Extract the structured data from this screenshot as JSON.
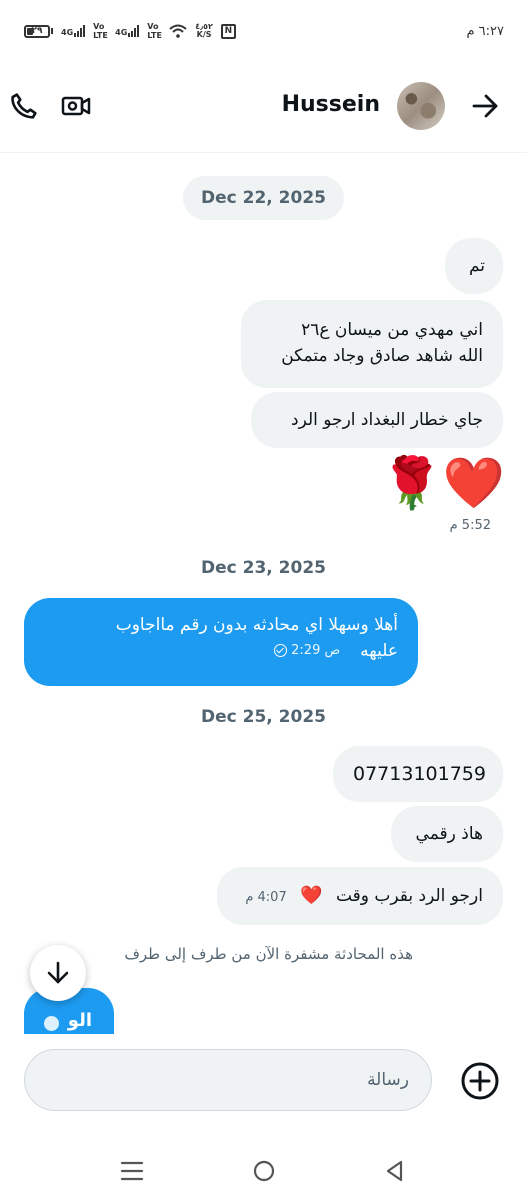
{
  "status_bar": {
    "time": "٦:٢٧ م",
    "battery_level": "٢٩",
    "network_1": "4G",
    "volte_1": "Vo LTE",
    "network_2": "4G",
    "volte_2": "Vo LTE",
    "speed_value": "٤٫٥٢",
    "speed_unit": "K/S",
    "nfc": "N"
  },
  "header": {
    "contact_name": "Hussein",
    "icons": [
      "phone-icon",
      "video-call-icon",
      "back-arrow-icon"
    ]
  },
  "date_separators": [
    "Dec 22, 2025",
    "Dec 23, 2025",
    "Dec 25, 2025"
  ],
  "messages": [
    {
      "text": "تم"
    },
    {
      "line1": "اني مهدي من ميسان ع٢٦",
      "line2": "الله شاهد صادق وجاد متمكن"
    },
    {
      "text": "جاي خطار البغداد ارجو الرد"
    },
    {
      "emojis": "❤️🌹",
      "time": "5:52 م"
    },
    {
      "line1": "أهلا وسهلا اي محادثه بدون رقم مااجاوب",
      "line2": "عليهه",
      "time": "2:29 ص"
    },
    {
      "text": "07713101759"
    },
    {
      "text": "هاذ رقمي"
    },
    {
      "text": "ارجو الرد بقرب وقت",
      "emoji": "❤️",
      "time": "4:07 م"
    }
  ],
  "encryption_note": "هذه المحادثة مشفرة الآن من طرف إلى طرف",
  "partial_bubble_text": "الو",
  "composer": {
    "placeholder": "رسالة"
  }
}
